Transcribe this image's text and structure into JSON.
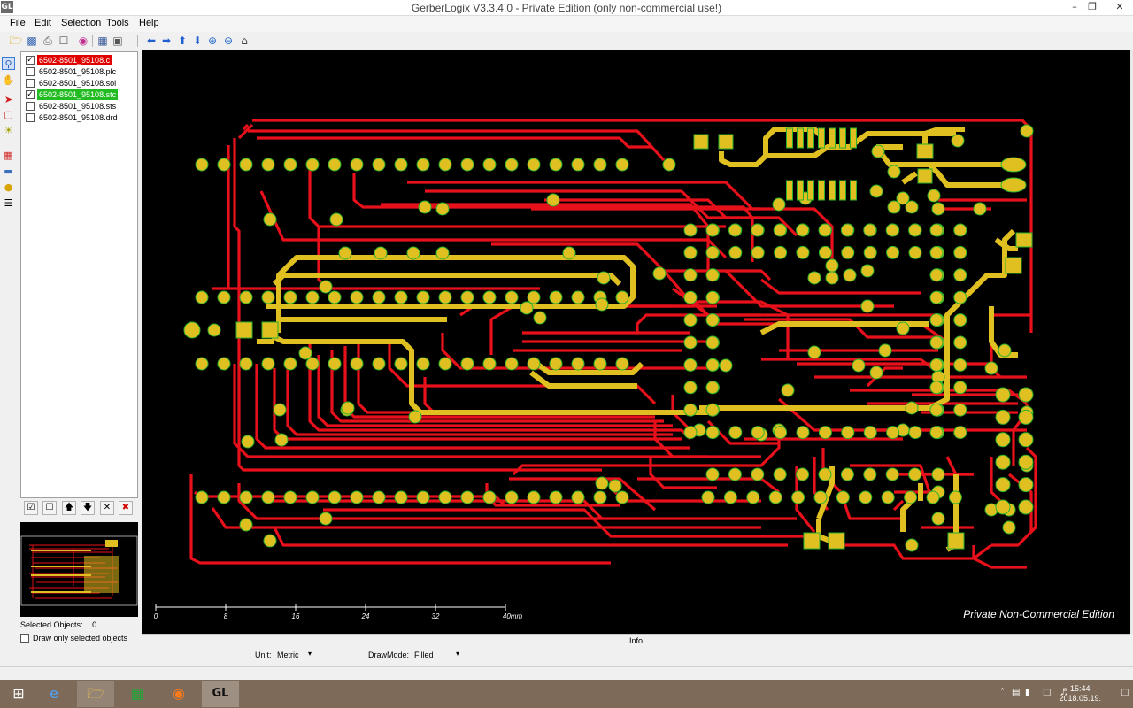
{
  "window": {
    "app_icon": "GL",
    "title": "GerberLogix V3.3.4.0   -   Private Edition (only non-commercial use!)",
    "min_icon": "minimize-icon",
    "max_icon": "restore-icon",
    "close_icon": "close-icon"
  },
  "menu": [
    "File",
    "Edit",
    "Selection",
    "Tools",
    "Help"
  ],
  "toolbar_icons": [
    "open-folder-icon",
    "save-icon",
    "print-icon",
    "print-preview-icon",
    "color-wheel-icon",
    "export-icon",
    "layers-icon",
    "arrow-left-icon",
    "arrow-right-icon",
    "arrow-up-icon",
    "arrow-down-icon",
    "zoom-in-icon",
    "zoom-out-icon",
    "home-icon"
  ],
  "left_tools": [
    "zoom-window-icon",
    "pan-hand-icon",
    "select-pointer-icon",
    "select-area-icon",
    "highlight-icon",
    "measure-icon",
    "board-icon",
    "bulb-icon",
    "stack-icon"
  ],
  "layers": [
    {
      "name": "6502-8501_95108.c",
      "checked": true,
      "color": "#e00000"
    },
    {
      "name": "6502-8501_95108.plc",
      "checked": false,
      "color": ""
    },
    {
      "name": "6502-8501_95108.sol",
      "checked": false,
      "color": ""
    },
    {
      "name": "6502-8501_95108.stc",
      "checked": true,
      "color": "#22bb22"
    },
    {
      "name": "6502-8501_95108.sts",
      "checked": false,
      "color": ""
    },
    {
      "name": "6502-8501_95108.drd",
      "checked": false,
      "color": ""
    }
  ],
  "layer_buttons": [
    "check-all-icon",
    "uncheck-all-icon",
    "move-up-icon",
    "move-down-icon",
    "remove-icon",
    "delete-icon"
  ],
  "selection": {
    "label": "Selected Objects:",
    "count": "0",
    "draw_only_label": "Draw only selected objects"
  },
  "scale": {
    "ticks": [
      "0",
      "8",
      "16",
      "24",
      "32",
      "40mm"
    ]
  },
  "watermark": "Private Non-Commercial Edition",
  "info_label": "Info",
  "unit": {
    "label": "Unit:",
    "value": "Metric"
  },
  "drawmode": {
    "label": "DrawMode:",
    "value": "Filled"
  },
  "colors": {
    "trace": "#e8101a",
    "pad": "#e0c020",
    "pad_outline": "#2bb12b",
    "canvas": "#000000"
  },
  "taskbar": {
    "items": [
      "windows-start-icon",
      "internet-explorer-icon",
      "file-explorer-icon",
      "store-icon",
      "firefox-icon",
      "gerberlogix-icon"
    ],
    "time": "15:44",
    "date": "2018.05.19."
  }
}
